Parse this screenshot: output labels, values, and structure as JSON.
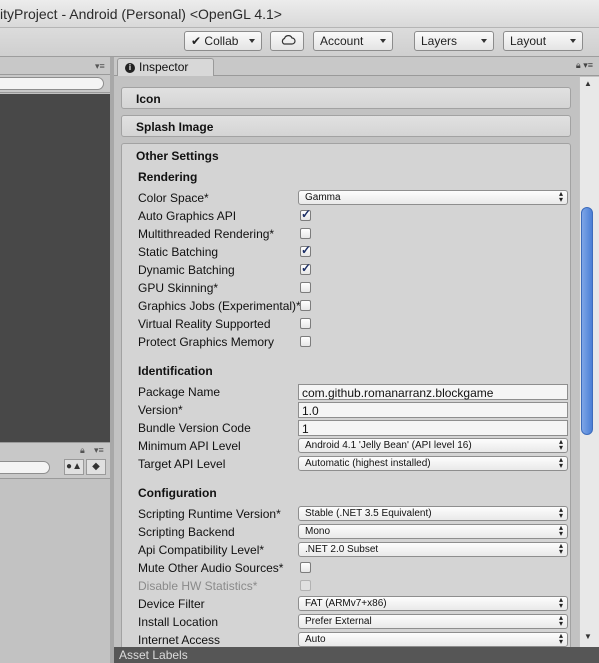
{
  "window": {
    "title": "ityProject - Android (Personal) <OpenGL 4.1>"
  },
  "toolbar": {
    "collab": "Collab",
    "account": "Account",
    "layers": "Layers",
    "layout": "Layout"
  },
  "inspector": {
    "tab_label": "Inspector",
    "sections": {
      "icon": "Icon",
      "splash": "Splash Image",
      "other": "Other Settings"
    },
    "rendering": {
      "header": "Rendering",
      "color_space": {
        "label": "Color Space*",
        "value": "Gamma"
      },
      "auto_graphics_api": {
        "label": "Auto Graphics API",
        "checked": true
      },
      "multithreaded_rendering": {
        "label": "Multithreaded Rendering*",
        "checked": false
      },
      "static_batching": {
        "label": "Static Batching",
        "checked": true
      },
      "dynamic_batching": {
        "label": "Dynamic Batching",
        "checked": true
      },
      "gpu_skinning": {
        "label": "GPU Skinning*",
        "checked": false
      },
      "graphics_jobs": {
        "label": "Graphics Jobs (Experimental)*",
        "checked": false
      },
      "virtual_reality": {
        "label": "Virtual Reality Supported",
        "checked": false
      },
      "protect_graphics_memory": {
        "label": "Protect Graphics Memory",
        "checked": false
      }
    },
    "identification": {
      "header": "Identification",
      "package_name": {
        "label": "Package Name",
        "value": "com.github.romanarranz.blockgame"
      },
      "version": {
        "label": "Version*",
        "value": "1.0"
      },
      "bundle_version_code": {
        "label": "Bundle Version Code",
        "value": "1"
      },
      "minimum_api_level": {
        "label": "Minimum API Level",
        "value": "Android 4.1 'Jelly Bean' (API level 16)"
      },
      "target_api_level": {
        "label": "Target API Level",
        "value": "Automatic (highest installed)"
      }
    },
    "configuration": {
      "header": "Configuration",
      "scripting_runtime_version": {
        "label": "Scripting Runtime Version*",
        "value": "Stable (.NET 3.5 Equivalent)"
      },
      "scripting_backend": {
        "label": "Scripting Backend",
        "value": "Mono"
      },
      "api_compatibility_level": {
        "label": "Api Compatibility Level*",
        "value": ".NET 2.0 Subset"
      },
      "mute_other_audio": {
        "label": "Mute Other Audio Sources*",
        "checked": false
      },
      "disable_hw_statistics": {
        "label": "Disable HW Statistics*",
        "checked": false,
        "disabled": true
      },
      "device_filter": {
        "label": "Device Filter",
        "value": "FAT (ARMv7+x86)"
      },
      "install_location": {
        "label": "Install Location",
        "value": "Prefer External"
      },
      "internet_access": {
        "label": "Internet Access",
        "value": "Auto"
      }
    }
  },
  "asset_labels": "Asset Labels",
  "colors": {
    "scene_bg": "#484848",
    "scroll_thumb": "#4a7fd6",
    "check": "#1c2f66"
  },
  "icons": [
    "cloud-icon",
    "check-circle-icon",
    "info-icon",
    "lock-icon",
    "menu-icon",
    "search-icon",
    "tag-icon"
  ]
}
